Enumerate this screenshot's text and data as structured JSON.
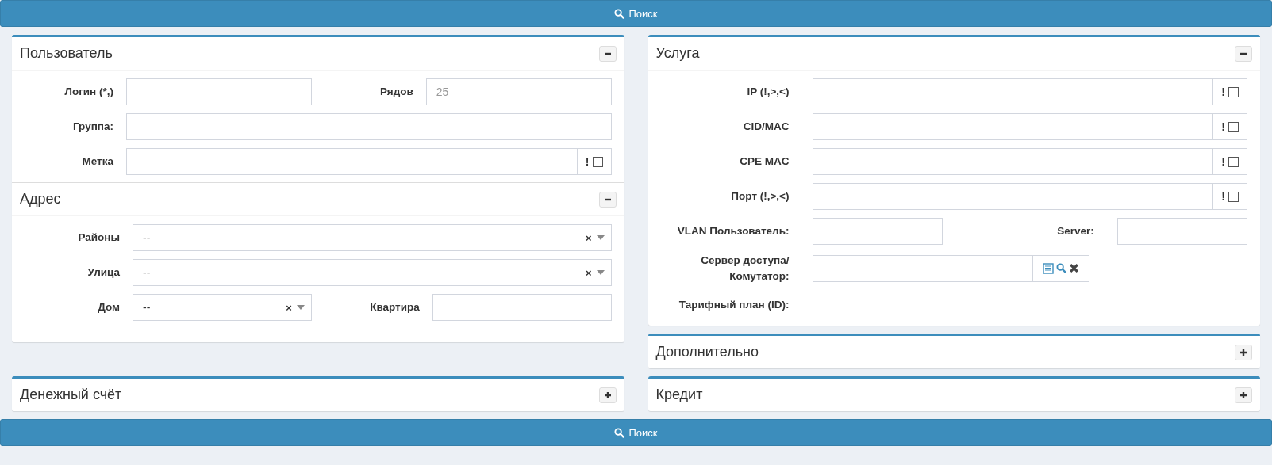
{
  "top_button": {
    "label": "Поиск"
  },
  "user_card": {
    "sections": [
      {
        "title": "Пользователь",
        "expanded": true,
        "rows": [
          {
            "fields": [
              {
                "kind": "text",
                "label": "Логин (*,)"
              },
              {
                "kind": "text",
                "label": "Рядов",
                "placeholder": "25"
              }
            ]
          },
          {
            "fields": [
              {
                "kind": "text",
                "label": "Группа:"
              }
            ]
          },
          {
            "fields": [
              {
                "kind": "flag",
                "label": "Метка",
                "flag": "!",
                "checked": false
              }
            ]
          }
        ]
      },
      {
        "title": "Адрес",
        "expanded": true,
        "rows": [
          {
            "fields": [
              {
                "kind": "select",
                "label": "Районы",
                "value": "--",
                "clear": "×"
              }
            ]
          },
          {
            "fields": [
              {
                "kind": "select",
                "label": "Улица",
                "value": "--",
                "clear": "×"
              }
            ]
          },
          {
            "fields": [
              {
                "kind": "select",
                "label": "Дом",
                "value": "--",
                "clear": "×"
              },
              {
                "kind": "text",
                "label": "Квартира"
              }
            ]
          }
        ]
      }
    ]
  },
  "service_card": {
    "sections": [
      {
        "title": "Услуга",
        "expanded": true,
        "rows": [
          {
            "fields": [
              {
                "kind": "flag",
                "label": "IP (!,>,<)",
                "flag": "!",
                "checked": false
              }
            ]
          },
          {
            "fields": [
              {
                "kind": "flag",
                "label": "CID/MAC",
                "flag": "!",
                "checked": false
              }
            ]
          },
          {
            "fields": [
              {
                "kind": "flag",
                "label": "CPE MAC",
                "flag": "!",
                "checked": false
              }
            ]
          },
          {
            "fields": [
              {
                "kind": "flag",
                "label": "Порт (!,>,<)",
                "flag": "!",
                "checked": false
              }
            ]
          },
          {
            "fields": [
              {
                "kind": "text",
                "label": "VLAN Пользователь:"
              },
              {
                "kind": "text",
                "label": "Server:"
              }
            ]
          },
          {
            "fields": [
              {
                "kind": "server",
                "label": "Сервер доступа/Комутатор:"
              }
            ]
          },
          {
            "fields": [
              {
                "kind": "text",
                "label": "Тарифный план (ID):"
              }
            ]
          }
        ]
      }
    ]
  },
  "extra_card": {
    "title": "Дополнительно",
    "expanded": false
  },
  "account_card": {
    "title": "Денежный счёт",
    "expanded": false
  },
  "credit_card": {
    "title": "Кредит",
    "expanded": false
  },
  "bottom_button": {
    "label": "Поиск"
  }
}
